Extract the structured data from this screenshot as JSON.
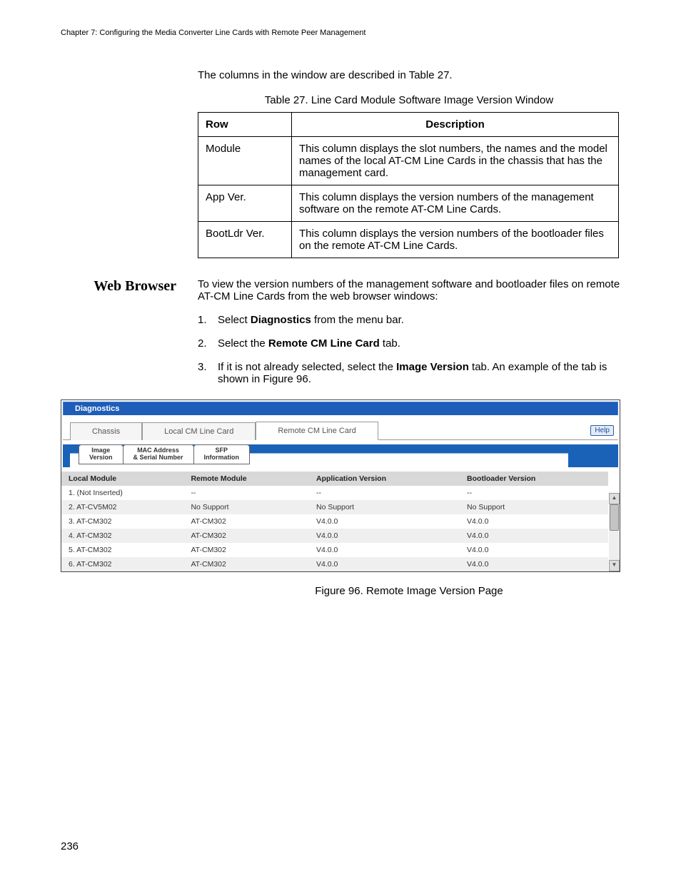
{
  "chapter_header": "Chapter 7: Configuring the Media Converter Line Cards with Remote Peer Management",
  "intro": "The columns in the window are described in Table 27.",
  "table_caption": "Table 27. Line Card Module Software Image Version Window",
  "table_headers": {
    "col1": "Row",
    "col2": "Description"
  },
  "table_rows": [
    {
      "row": "Module",
      "desc": "This column displays the slot numbers, the names and the model names of the local AT-CM Line Cards in the chassis that has the management card."
    },
    {
      "row": "App Ver.",
      "desc": "This column displays the version numbers of the management software on the remote AT-CM Line Cards."
    },
    {
      "row": "BootLdr Ver.",
      "desc": "This column displays the version numbers of the bootloader files on the remote AT-CM Line Cards."
    }
  ],
  "section_title": "Web Browser",
  "section_intro": "To view the version numbers of the management software and bootloader files on remote AT-CM Line Cards from the web browser windows:",
  "steps": {
    "s1_pre": "Select ",
    "s1_b": "Diagnostics",
    "s1_post": " from the menu bar.",
    "s2_pre": "Select the ",
    "s2_b": "Remote CM Line Card",
    "s2_post": " tab.",
    "s3_pre": "If it is not already selected, select the ",
    "s3_b": "Image Version",
    "s3_post": " tab. An example of the tab is shown in Figure 96."
  },
  "ui": {
    "title": "Diagnostics",
    "help": "Help",
    "tabs": {
      "t1": "Chassis",
      "t2": "Local CM Line Card",
      "t3": "Remote CM Line Card"
    },
    "subtabs": {
      "s1a": "Image",
      "s1b": "Version",
      "s2a": "MAC Address",
      "s2b": "& Serial Number",
      "s3a": "SFP",
      "s3b": "Information"
    },
    "cols": {
      "c1": "Local Module",
      "c2": "Remote Module",
      "c3": "Application Version",
      "c4": "Bootloader Version"
    },
    "rows": [
      {
        "c1": "1. (Not Inserted)",
        "c2": "--",
        "c3": "--",
        "c4": "--"
      },
      {
        "c1": "2. AT-CV5M02",
        "c2": "No Support",
        "c3": "No Support",
        "c4": "No Support"
      },
      {
        "c1": "3. AT-CM302",
        "c2": "AT-CM302",
        "c3": "V4.0.0",
        "c4": "V4.0.0"
      },
      {
        "c1": "4. AT-CM302",
        "c2": "AT-CM302",
        "c3": "V4.0.0",
        "c4": "V4.0.0"
      },
      {
        "c1": "5. AT-CM302",
        "c2": "AT-CM302",
        "c3": "V4.0.0",
        "c4": "V4.0.0"
      },
      {
        "c1": "6. AT-CM302",
        "c2": "AT-CM302",
        "c3": "V4.0.0",
        "c4": "V4.0.0"
      }
    ]
  },
  "figure_caption": "Figure 96. Remote Image Version Page",
  "page_num": "236"
}
